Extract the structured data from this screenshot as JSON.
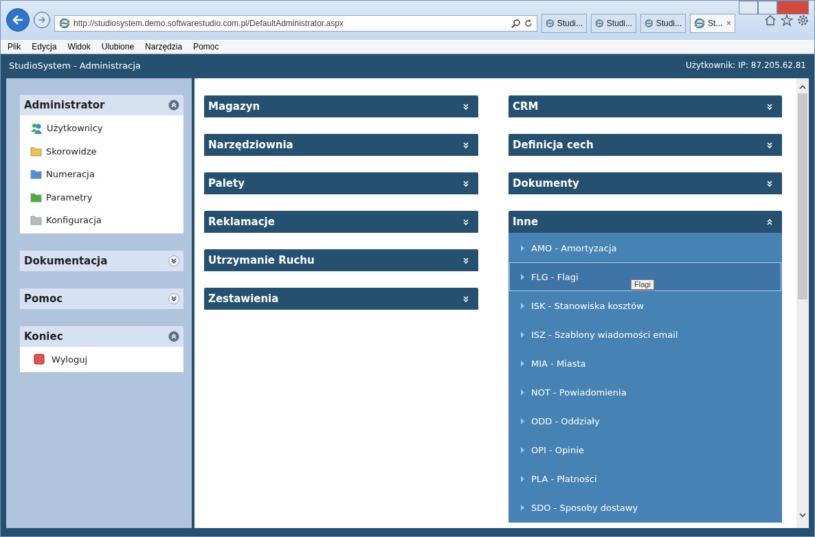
{
  "browser": {
    "url": "http://studiosystem.demo.softwarestudio.com.pl/DefaultAdministrator.aspx",
    "tabs": [
      {
        "label": "Studi...",
        "selected": false
      },
      {
        "label": "Studi...",
        "selected": false
      },
      {
        "label": "Studi...",
        "selected": false
      },
      {
        "label": "St...",
        "selected": true,
        "close": "×"
      }
    ],
    "menu": [
      "Plik",
      "Edycja",
      "Widok",
      "Ulubione",
      "Narzędzia",
      "Pomoc"
    ]
  },
  "app": {
    "title": "StudioSystem - Administracja",
    "user": "Użytkownik: IP: 87.205.62.81"
  },
  "sidebar": [
    {
      "title": "Administrator",
      "expanded": true,
      "items": [
        {
          "label": "Użytkownicy",
          "kind": "users"
        },
        {
          "label": "Skorowidze",
          "kind": "folder",
          "color": "#f2c04c"
        },
        {
          "label": "Numeracja",
          "kind": "folder",
          "color": "#4a8fdc"
        },
        {
          "label": "Parametry",
          "kind": "folder",
          "color": "#4caf3c"
        },
        {
          "label": "Konfiguracja",
          "kind": "folder",
          "color": "#b8bcc2"
        }
      ]
    },
    {
      "title": "Dokumentacja",
      "expanded": false
    },
    {
      "title": "Pomoc",
      "expanded": false
    },
    {
      "title": "Koniec",
      "expanded": true,
      "items": [
        {
          "label": "Wyloguj",
          "kind": "logout"
        }
      ]
    }
  ],
  "columns": [
    [
      {
        "title": "Magazyn",
        "expanded": false
      },
      {
        "title": "Narzędziownia",
        "expanded": false
      },
      {
        "title": "Palety",
        "expanded": false
      },
      {
        "title": "Reklamacje",
        "expanded": false
      },
      {
        "title": "Utrzymanie Ruchu",
        "expanded": false
      },
      {
        "title": "Zestawienia",
        "expanded": false
      }
    ],
    [
      {
        "title": "CRM",
        "expanded": false
      },
      {
        "title": "Definicja cech",
        "expanded": false
      },
      {
        "title": "Dokumenty",
        "expanded": false
      },
      {
        "title": "Inne",
        "expanded": true,
        "items": [
          {
            "label": "AMO - Amortyzacja",
            "selected": false
          },
          {
            "label": "FLG - Flagi",
            "selected": true,
            "tooltip": "Flagi"
          },
          {
            "label": "ISK - Stanowiska kosztów",
            "selected": false
          },
          {
            "label": "ISZ - Szablony wiadomości email",
            "selected": false
          },
          {
            "label": "MIA - Miasta",
            "selected": false
          },
          {
            "label": "NOT - Powiadomienia",
            "selected": false
          },
          {
            "label": "ODD - Oddziały",
            "selected": false
          },
          {
            "label": "OPI - Opinie",
            "selected": false
          },
          {
            "label": "PLA - Płatności",
            "selected": false
          },
          {
            "label": "SDO - Sposoby dostawy",
            "selected": false
          }
        ]
      }
    ]
  ]
}
